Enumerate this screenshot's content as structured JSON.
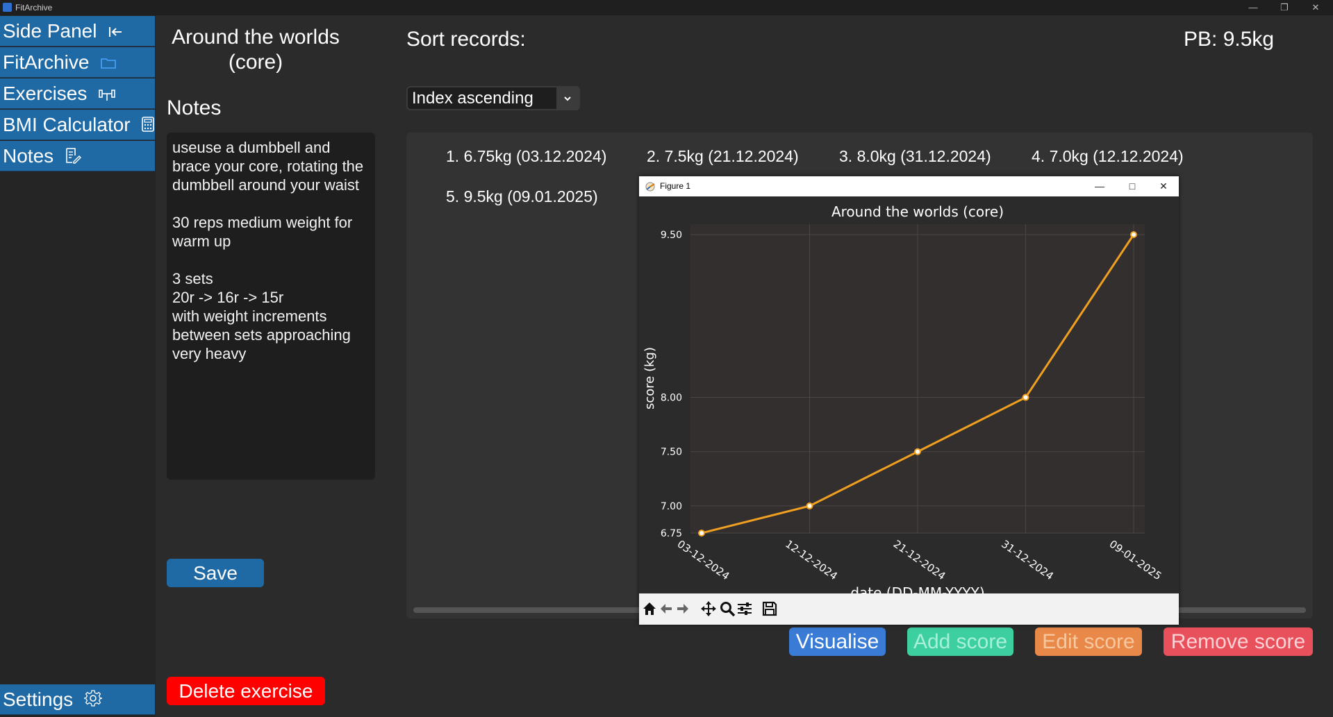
{
  "window": {
    "title": "FitArchive",
    "minimize": "—",
    "maximize": "❐",
    "close": "✕"
  },
  "sidebar": {
    "items": [
      {
        "label": "Side Panel",
        "icon": "collapse-left-icon"
      },
      {
        "label": "FitArchive",
        "icon": "folder-icon"
      },
      {
        "label": "Exercises",
        "icon": "dumbbell-icon"
      },
      {
        "label": "BMI Calculator",
        "icon": "calculator-icon"
      },
      {
        "label": "Notes",
        "icon": "notes-icon"
      }
    ],
    "settings": {
      "label": "Settings",
      "icon": "gear-icon"
    }
  },
  "exercise": {
    "title_line1": "Around the worlds",
    "title_line2": "(core)"
  },
  "notes": {
    "heading": "Notes",
    "text": "useuse a dumbbell and brace your core, rotating the dumbbell around your waist\n\n30 reps medium weight for warm up\n\n3 sets\n20r -> 16r -> 15r\nwith weight increments between sets approaching very heavy"
  },
  "buttons": {
    "save": "Save",
    "delete": "Delete exercise",
    "visualise": "Visualise",
    "add_score": "Add score",
    "edit_score": "Edit score",
    "remove_score": "Remove score"
  },
  "colors": {
    "accent_blue": "#1f6aa5",
    "visualise": "#3a7bd5",
    "add_score": "#3ecfa0",
    "edit_score": "#e8894a",
    "remove_score": "#e8505b",
    "delete": "#ff0000",
    "line": "#f0a020"
  },
  "sort": {
    "label": "Sort records:",
    "selected": "Index ascending"
  },
  "pb": "PB: 9.5kg",
  "records": [
    "1. 6.75kg (03.12.2024)",
    "2. 7.5kg (21.12.2024)",
    "3. 8.0kg (31.12.2024)",
    "4. 7.0kg (12.12.2024)",
    "5. 9.5kg (09.01.2025)"
  ],
  "figure": {
    "window_title": "Figure 1",
    "minimize": "—",
    "maximize": "□",
    "close": "✕",
    "toolbar": [
      "home-icon",
      "back-icon",
      "forward-icon",
      "pan-icon",
      "zoom-icon",
      "configure-icon",
      "save-icon"
    ]
  },
  "chart_data": {
    "type": "line",
    "title": "Around the worlds (core)",
    "xlabel": "date (DD-MM-YYYY)",
    "ylabel": "score (kg)",
    "x": [
      "03-12-2024",
      "12-12-2024",
      "21-12-2024",
      "31-12-2024",
      "09-01-2025"
    ],
    "y": [
      6.75,
      7.0,
      7.5,
      8.0,
      9.5
    ],
    "ylim": [
      6.75,
      9.5
    ],
    "yticks": [
      "6.75",
      "7.00",
      "7.50",
      "8.00",
      "9.50"
    ],
    "grid": true,
    "line_color": "#f0a020"
  }
}
